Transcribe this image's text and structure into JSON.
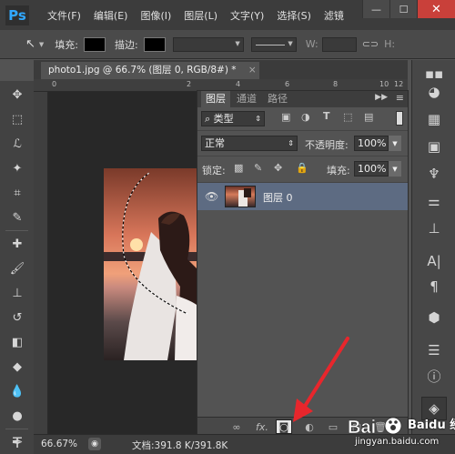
{
  "app": {
    "logo": "Ps"
  },
  "menu": [
    "文件(F)",
    "编辑(E)",
    "图像(I)",
    "图层(L)",
    "文字(Y)",
    "选择(S)",
    "滤镜"
  ],
  "window_controls": {
    "minimize": "—",
    "maximize": "☐",
    "close": "✕"
  },
  "options_bar": {
    "fill_label": "填充:",
    "stroke_label": "描边:",
    "width_label": "W:",
    "link_icon": "link-icon",
    "height_label": "H:"
  },
  "document_tab": {
    "title": "photo1.jpg @ 66.7% (图层 0, RGB/8#) *",
    "close": "×"
  },
  "ruler": {
    "labels": [
      "0",
      "2",
      "4",
      "6",
      "8",
      "10",
      "12"
    ]
  },
  "layers_panel": {
    "tabs": [
      "图层",
      "通道",
      "路径"
    ],
    "filter_kind": "类型",
    "blend_mode": "正常",
    "opacity_label": "不透明度:",
    "opacity_value": "100%",
    "lock_label": "锁定:",
    "fill_label": "填充:",
    "fill_value": "100%",
    "layers": [
      {
        "name": "图层 0",
        "visible": true
      }
    ],
    "footer_icons": [
      "link-layers-icon",
      "fx-icon",
      "add-mask-icon",
      "adjustment-icon",
      "new-group-icon",
      "new-layer-icon",
      "delete-icon"
    ],
    "fx_label": "fx."
  },
  "status_bar": {
    "zoom": "66.67%",
    "doc_info": "文档:391.8 K/391.8K"
  },
  "watermark": {
    "brand": "Baidu 经验",
    "url": "jingyan.baidu.com"
  },
  "colors": {
    "accent": "#31a8ff",
    "selected_layer": "#5d6b82",
    "arrow": "#e8262c",
    "close": "#c9403a"
  }
}
